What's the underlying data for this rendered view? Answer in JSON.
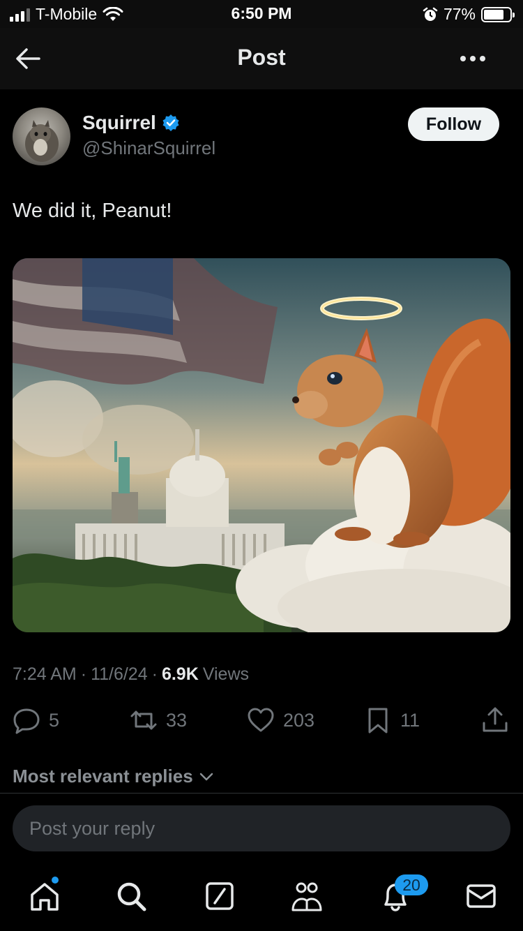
{
  "status_bar": {
    "carrier": "T-Mobile",
    "time": "6:50 PM",
    "battery_percent": "77%",
    "battery_level": 0.77,
    "icons": [
      "signal-icon",
      "wifi-icon",
      "alarm-icon",
      "battery-icon"
    ]
  },
  "header": {
    "title": "Post",
    "back_icon": "arrow-left-icon",
    "more_icon": "more-horizontal-icon"
  },
  "post": {
    "author_name": "Squirrel",
    "author_handle": "@ShinarSquirrel",
    "verified": true,
    "follow_label": "Follow",
    "text": "We did it, Peanut!",
    "time": "7:24 AM",
    "date": "11/6/24",
    "views_count": "6.9K",
    "views_label": "Views",
    "separator": "·"
  },
  "actions": {
    "replies": "5",
    "reposts": "33",
    "likes": "203",
    "bookmarks": "11"
  },
  "replies_section": {
    "label": "Most relevant replies",
    "reply_placeholder": "Post your reply"
  },
  "tab_bar": {
    "items": [
      "home-icon",
      "search-icon",
      "grok-icon",
      "communities-icon",
      "notifications-icon",
      "messages-icon"
    ],
    "notifications_badge": "20"
  },
  "colors": {
    "accent": "#1d9bf0",
    "background": "#000000",
    "muted_text": "#71767b"
  }
}
